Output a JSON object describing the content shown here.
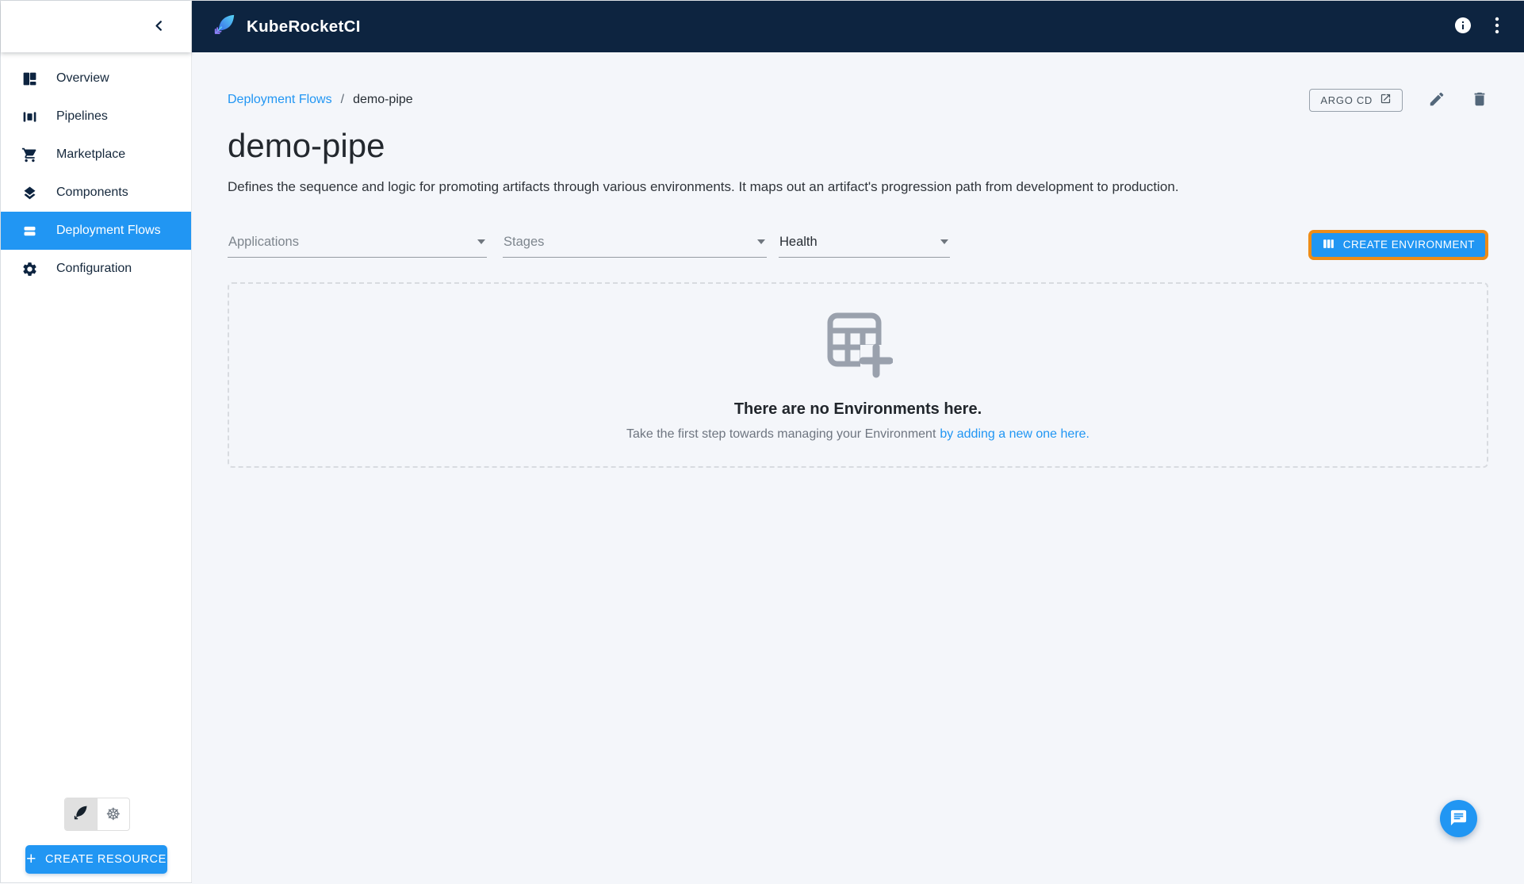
{
  "colors": {
    "accent_blue": "#2196f3",
    "header_navy": "#0d2440",
    "highlight_orange": "#ee8c17",
    "content_bg": "#f4f6fa"
  },
  "header": {
    "app_name": "KubeRocketCI"
  },
  "sidebar": {
    "items": [
      {
        "label": "Overview",
        "icon": "dashboard-icon",
        "active": false
      },
      {
        "label": "Pipelines",
        "icon": "pipelines-icon",
        "active": false
      },
      {
        "label": "Marketplace",
        "icon": "cart-icon",
        "active": false
      },
      {
        "label": "Components",
        "icon": "components-icon",
        "active": false
      },
      {
        "label": "Deployment Flows",
        "icon": "deployment-flows-icon",
        "active": true
      },
      {
        "label": "Configuration",
        "icon": "gear-icon",
        "active": false
      }
    ],
    "create_resource_label": "CREATE RESOURCE"
  },
  "breadcrumb": {
    "parent": "Deployment Flows",
    "separator": "/",
    "current": "demo-pipe"
  },
  "page": {
    "title": "demo-pipe",
    "description": "Defines the sequence and logic for promoting artifacts through various environments. It maps out an artifact's progression path from development to production.",
    "argo_cd_label": "ARGO CD"
  },
  "filters": {
    "applications": "Applications",
    "stages": "Stages",
    "health": "Health"
  },
  "create_environment_label": "CREATE ENVIRONMENT",
  "empty_state": {
    "title": "There are no Environments here.",
    "subtitle": "Take the first step towards managing your Environment",
    "subtitle_link": "by adding a new one here."
  }
}
